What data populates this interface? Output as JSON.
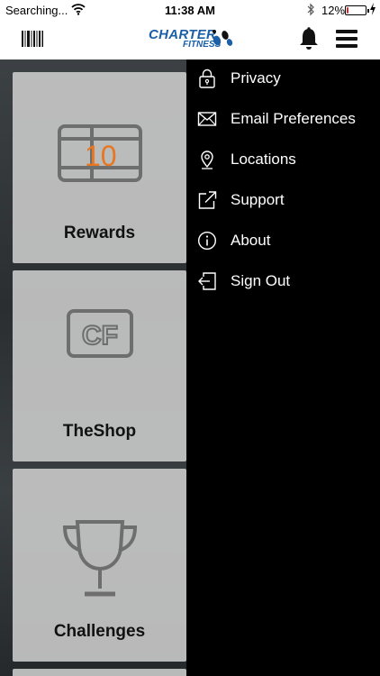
{
  "status_bar": {
    "carrier": "Searching...",
    "time": "11:38 AM",
    "battery_percent": "12%",
    "battery_level": 0.12,
    "battery_color": "#e0262a"
  },
  "header": {
    "logo_line1": "CHARTER",
    "logo_line2": "FITNESS",
    "brand_color": "#1b5fa6",
    "left_icon": "barcode-icon",
    "right_icons": [
      "bell-icon",
      "hamburger-menu-icon"
    ]
  },
  "tiles": [
    {
      "label": "Rewards",
      "icon": "rewards-card-icon",
      "icon_text": "10",
      "icon_accent": "#e87722"
    },
    {
      "label": "TheShop",
      "icon": "shop-logo-icon",
      "icon_text": "CF"
    },
    {
      "label": "Challenges",
      "icon": "trophy-icon"
    }
  ],
  "drawer": {
    "items": [
      {
        "label": "Privacy",
        "icon": "lock-icon"
      },
      {
        "label": "Email Preferences",
        "icon": "envelope-icon"
      },
      {
        "label": "Locations",
        "icon": "location-pin-icon"
      },
      {
        "label": "Support",
        "icon": "external-link-icon"
      },
      {
        "label": "About",
        "icon": "info-icon"
      },
      {
        "label": "Sign Out",
        "icon": "sign-out-icon"
      }
    ]
  }
}
